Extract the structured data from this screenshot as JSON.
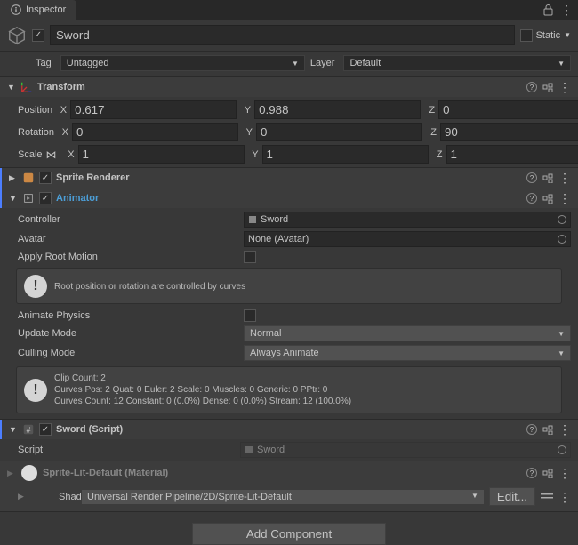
{
  "tab": {
    "title": "Inspector"
  },
  "object": {
    "name": "Sword",
    "static_label": "Static",
    "tag_label": "Tag",
    "tag_value": "Untagged",
    "layer_label": "Layer",
    "layer_value": "Default"
  },
  "transform": {
    "title": "Transform",
    "position": {
      "label": "Position",
      "x": "0.617",
      "y": "0.988",
      "z": "0"
    },
    "rotation": {
      "label": "Rotation",
      "x": "0",
      "y": "0",
      "z": "90"
    },
    "scale": {
      "label": "Scale",
      "x": "1",
      "y": "1",
      "z": "1"
    }
  },
  "sprite_renderer": {
    "title": "Sprite Renderer"
  },
  "animator": {
    "title": "Animator",
    "controller_label": "Controller",
    "controller_value": "Sword",
    "avatar_label": "Avatar",
    "avatar_value": "None (Avatar)",
    "root_motion_label": "Apply Root Motion",
    "root_motion_info": "Root position or rotation are controlled by curves",
    "animate_physics_label": "Animate Physics",
    "update_mode_label": "Update Mode",
    "update_mode_value": "Normal",
    "culling_mode_label": "Culling Mode",
    "culling_mode_value": "Always Animate",
    "stats_line1": "Clip Count: 2",
    "stats_line2": "Curves Pos: 2 Quat: 0 Euler: 2 Scale: 0 Muscles: 0 Generic: 0 PPtr: 0",
    "stats_line3": "Curves Count: 12 Constant: 0 (0.0%) Dense: 0 (0.0%) Stream: 12 (100.0%)"
  },
  "sword_script": {
    "title": "Sword (Script)",
    "script_label": "Script",
    "script_value": "Sword"
  },
  "material": {
    "title": "Sprite-Lit-Default (Material)",
    "shader_label": "Shader",
    "shader_value": "Universal Render Pipeline/2D/Sprite-Lit-Default",
    "edit_label": "Edit..."
  },
  "add_component": "Add Component",
  "axis": {
    "x": "X",
    "y": "Y",
    "z": "Z"
  }
}
